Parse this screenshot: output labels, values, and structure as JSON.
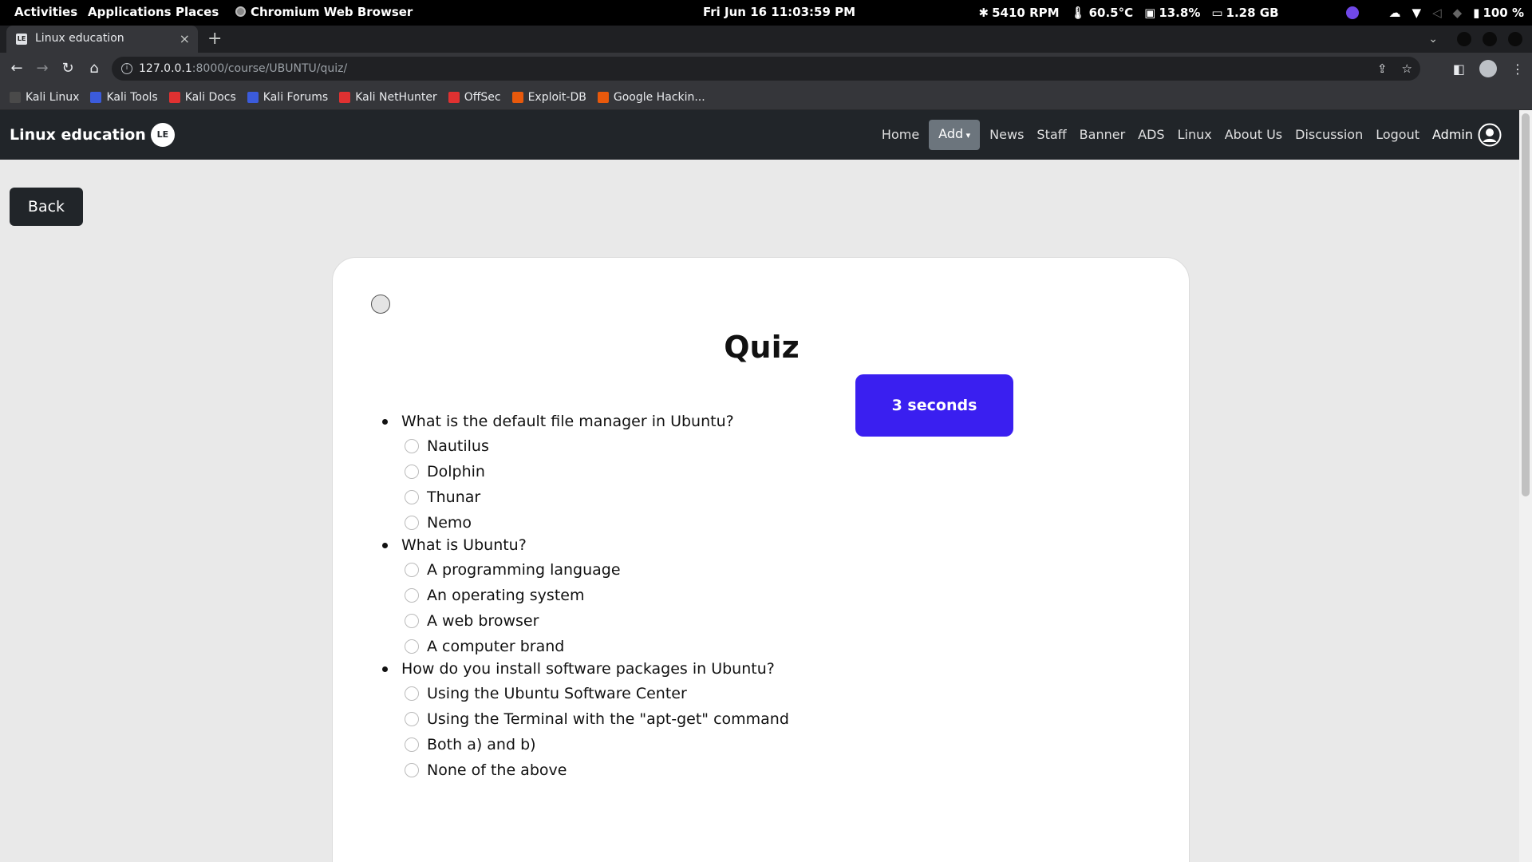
{
  "topbar": {
    "activities": "Activities",
    "applications": "Applications",
    "places": "Places",
    "app_name": "Chromium Web Browser",
    "clock": "Fri Jun 16  11:03:59 PM",
    "fan": "5410 RPM",
    "temp": "60.5°C",
    "cpu": "13.8%",
    "mem": "1.28 GB",
    "battery": "100 %"
  },
  "browser": {
    "tab_title": "Linux education",
    "tab_favicon": "LE",
    "tab_close": "×",
    "new_tab": "+",
    "tab_dropdown": "⌄",
    "url_host": "127.0.0.1",
    "url_rest": ":8000/course/UBUNTU/quiz/",
    "bookmarks": [
      {
        "label": "Kali Linux",
        "color": "#4a4a4a"
      },
      {
        "label": "Kali Tools",
        "color": "#3b5bdb"
      },
      {
        "label": "Kali Docs",
        "color": "#e03131"
      },
      {
        "label": "Kali Forums",
        "color": "#3b5bdb"
      },
      {
        "label": "Kali NetHunter",
        "color": "#e03131"
      },
      {
        "label": "OffSec",
        "color": "#e03131"
      },
      {
        "label": "Exploit-DB",
        "color": "#e8590c"
      },
      {
        "label": "Google Hackin...",
        "color": "#e8590c"
      }
    ]
  },
  "site": {
    "brand": "Linux education",
    "brand_logo": "LE",
    "nav": [
      "Home",
      "Add",
      "News",
      "Staff",
      "Banner",
      "ADS",
      "Linux",
      "About Us",
      "Discussion",
      "Logout"
    ],
    "user": "Admin",
    "back": "Back"
  },
  "quiz": {
    "title": "Quiz",
    "timer": "3 seconds",
    "accent": "#3a1ff0",
    "questions": [
      {
        "text": "What is the default file manager in Ubuntu?",
        "options": [
          "Nautilus",
          "Dolphin",
          "Thunar",
          "Nemo"
        ]
      },
      {
        "text": "What is Ubuntu?",
        "options": [
          "A programming language",
          "An operating system",
          "A web browser",
          "A computer brand"
        ]
      },
      {
        "text": "How do you install software packages in Ubuntu?",
        "options": [
          "Using the Ubuntu Software Center",
          "Using the Terminal with the \"apt-get\" command",
          "Both a) and b)",
          "None of the above"
        ]
      }
    ]
  }
}
